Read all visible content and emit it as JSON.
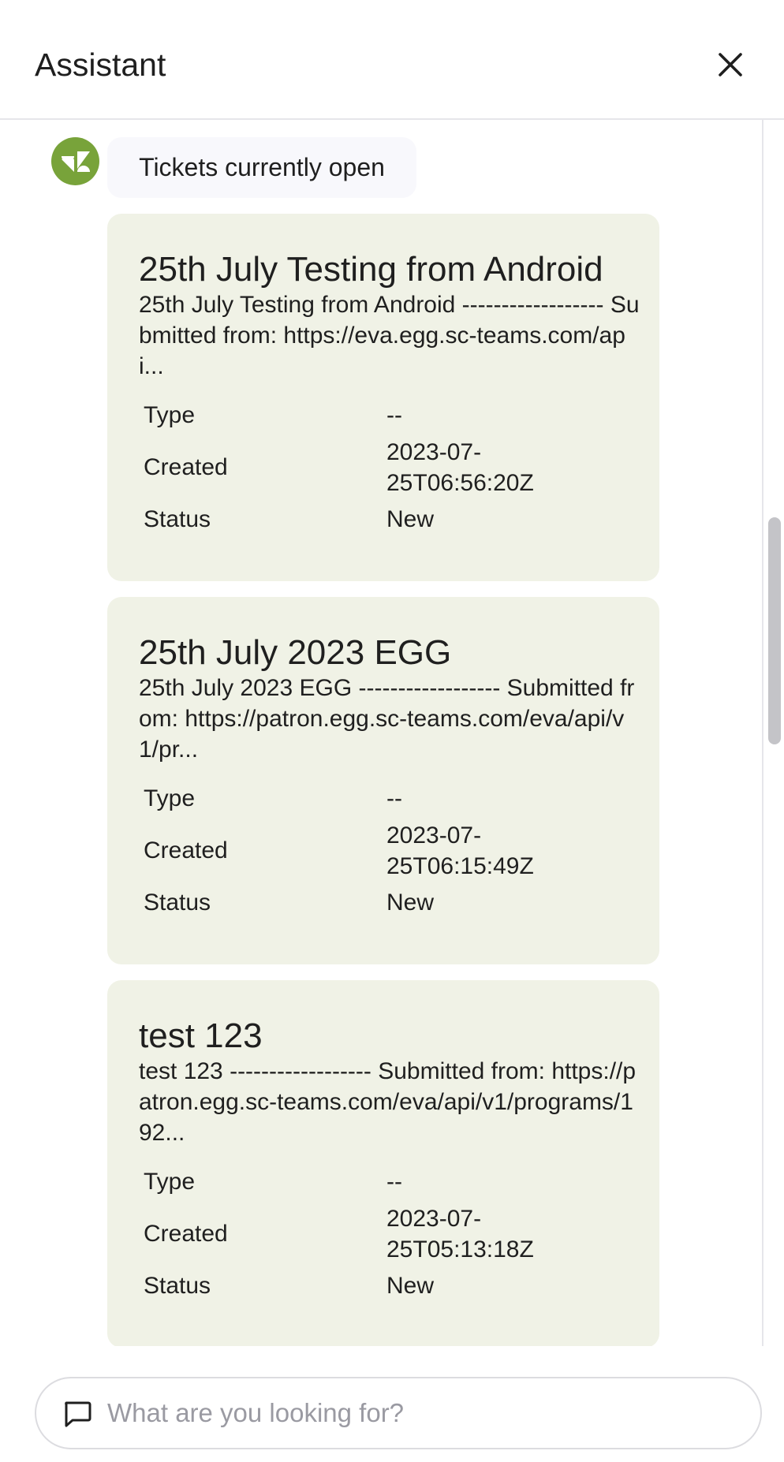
{
  "header": {
    "title": "Assistant",
    "close_icon": "close-icon"
  },
  "message": {
    "avatar_icon": "zendesk-logo-icon",
    "avatar_color": "#78a33a",
    "text": "Tickets currently open"
  },
  "tickets": [
    {
      "title": "25th July Testing from Android",
      "description": "25th July Testing from Android ------------------ Submitted from: https://eva.egg.sc-teams.com/api...",
      "fields": [
        {
          "label": "Type",
          "value": "--"
        },
        {
          "label": "Created",
          "value": "2023-07-25T06:56:20Z"
        },
        {
          "label": "Status",
          "value": "New"
        }
      ]
    },
    {
      "title": "25th July 2023 EGG",
      "description": "25th July 2023 EGG ------------------ Submitted from: https://patron.egg.sc-teams.com/eva/api/v1/pr...",
      "fields": [
        {
          "label": "Type",
          "value": "--"
        },
        {
          "label": "Created",
          "value": "2023-07-25T06:15:49Z"
        },
        {
          "label": "Status",
          "value": "New"
        }
      ]
    },
    {
      "title": "test 123",
      "description": "test 123 ------------------ Submitted from: https://patron.egg.sc-teams.com/eva/api/v1/programs/192...",
      "fields": [
        {
          "label": "Type",
          "value": "--"
        },
        {
          "label": "Created",
          "value": "2023-07-25T05:13:18Z"
        },
        {
          "label": "Status",
          "value": "New"
        }
      ]
    }
  ],
  "search": {
    "placeholder": "What are you looking for?",
    "icon": "chat-bubble-icon"
  },
  "colors": {
    "card_background": "#f0f2e6",
    "bubble_background": "#f8f8fc",
    "brand": "#78a33a"
  }
}
